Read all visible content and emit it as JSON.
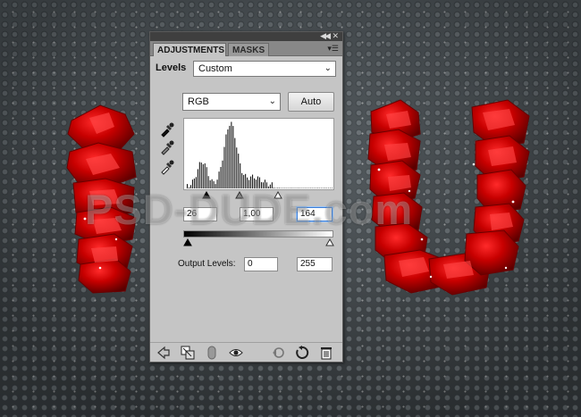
{
  "watermark": "PSD-DUDE.com",
  "panel": {
    "tabs": [
      {
        "label": "ADJUSTMENTS",
        "active": true
      },
      {
        "label": "MASKS",
        "active": false
      }
    ],
    "levels_label": "Levels",
    "preset": "Custom",
    "channel": "RGB",
    "auto_label": "Auto",
    "input_levels": {
      "black": "26",
      "gamma": "1,00",
      "white": "164"
    },
    "output_label": "Output Levels:",
    "output_levels": {
      "black": "0",
      "white": "255"
    }
  },
  "icons": {
    "titlebar": [
      "collapse-icon",
      "close-icon"
    ],
    "tabbar": [
      "panel-menu-icon"
    ],
    "eyedroppers": [
      "black-point-eyedropper-icon",
      "gray-point-eyedropper-icon",
      "white-point-eyedropper-icon"
    ],
    "bottom": [
      "back-arrow-icon",
      "clip-to-layer-icon",
      "mask-icon",
      "visibility-eye-icon",
      "previous-state-icon",
      "reset-icon",
      "trash-icon"
    ]
  },
  "colors": {
    "panel_bg": "#c5c5c5",
    "rose_red": "#c00000",
    "focus_blue": "#3d7fd8"
  }
}
